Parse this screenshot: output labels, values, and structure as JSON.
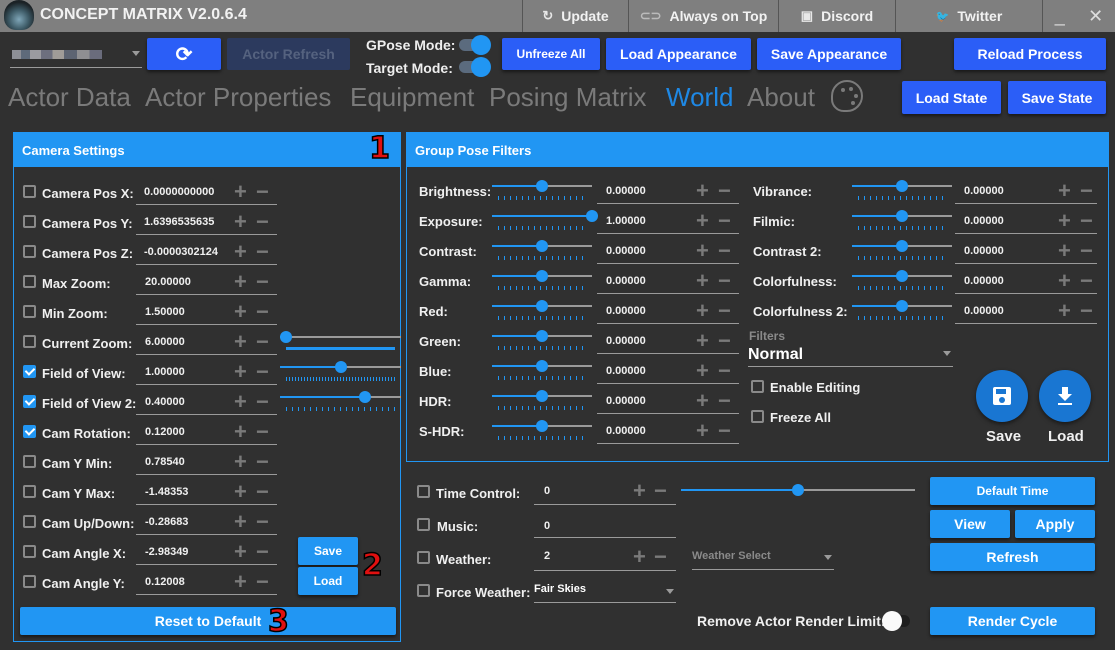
{
  "app": {
    "title": "CONCEPT MATRIX V2.0.6.4"
  },
  "titlebar": {
    "buttons": [
      {
        "label": "Update",
        "icon": "update-icon",
        "glyph": "↻"
      },
      {
        "label": "Always on Top",
        "icon": "toggle-icon",
        "glyph": "⊂⊃"
      },
      {
        "label": "Discord",
        "icon": "discord-icon",
        "glyph": "▣"
      },
      {
        "label": "Twitter",
        "icon": "twitter-icon",
        "glyph": "🐦"
      }
    ],
    "minimize": "_",
    "close": "✕"
  },
  "toolbar": {
    "refresh_glyph": "⟳",
    "actor_refresh": "Actor Refresh",
    "gpose_mode": "GPose Mode:",
    "target_mode": "Target Mode:",
    "gpose_on": true,
    "target_on": true,
    "unfreeze_all": "Unfreeze All",
    "load_appearance": "Load Appearance",
    "save_appearance": "Save Appearance",
    "reload_process": "Reload Process",
    "load_state": "Load State",
    "save_state": "Save State"
  },
  "tabs": [
    {
      "label": "Actor Data",
      "active": false
    },
    {
      "label": "Actor Properties",
      "active": false
    },
    {
      "label": "Equipment",
      "active": false
    },
    {
      "label": "Posing Matrix",
      "active": false
    },
    {
      "label": "World",
      "active": true
    },
    {
      "label": "About",
      "active": false
    }
  ],
  "palette_glyph": "🎨",
  "camera": {
    "title": "Camera Settings",
    "marker1": "1",
    "marker2": "2",
    "marker3": "3",
    "rows": [
      {
        "label": "Camera Pos X:",
        "value": "0.0000000000",
        "checked": false
      },
      {
        "label": "Camera Pos Y:",
        "value": "1.6396535635",
        "checked": false
      },
      {
        "label": "Camera Pos Z:",
        "value": "-0.0000302124",
        "checked": false
      },
      {
        "label": "Max Zoom:",
        "value": "20.00000",
        "checked": false
      },
      {
        "label": "Min Zoom:",
        "value": "1.50000",
        "checked": false
      },
      {
        "label": "Current Zoom:",
        "value": "6.00000",
        "checked": false
      },
      {
        "label": "Field of View:",
        "value": "1.00000",
        "checked": true
      },
      {
        "label": "Field of View 2:",
        "value": "0.40000",
        "checked": true
      },
      {
        "label": "Cam Rotation:",
        "value": "0.12000",
        "checked": true
      },
      {
        "label": "Cam Y Min:",
        "value": "0.78540",
        "checked": false
      },
      {
        "label": "Cam Y Max:",
        "value": "-1.48353",
        "checked": false
      },
      {
        "label": "Cam Up/Down:",
        "value": "-0.28683",
        "checked": false
      },
      {
        "label": "Cam Angle X:",
        "value": "-2.98349",
        "checked": false
      },
      {
        "label": "Cam Angle Y:",
        "value": "0.12008",
        "checked": false
      }
    ],
    "sliders": {
      "current_zoom": 0.05,
      "field_of_view": 0.5,
      "field_of_view_2": 0.7
    },
    "save": "Save",
    "load": "Load",
    "reset": "Reset to Default"
  },
  "filters": {
    "title": "Group Pose Filters",
    "left": [
      {
        "label": "Brightness:",
        "value": "0.00000",
        "pos": 0.5
      },
      {
        "label": "Exposure:",
        "value": "1.00000",
        "pos": 1.0
      },
      {
        "label": "Contrast:",
        "value": "0.00000",
        "pos": 0.5
      },
      {
        "label": "Gamma:",
        "value": "0.00000",
        "pos": 0.5
      },
      {
        "label": "Red:",
        "value": "0.00000",
        "pos": 0.5
      },
      {
        "label": "Green:",
        "value": "0.00000",
        "pos": 0.5
      },
      {
        "label": "Blue:",
        "value": "0.00000",
        "pos": 0.5
      },
      {
        "label": "HDR:",
        "value": "0.00000",
        "pos": 0.5
      },
      {
        "label": "S-HDR:",
        "value": "0.00000",
        "pos": 0.5
      }
    ],
    "right": [
      {
        "label": "Vibrance:",
        "value": "0.00000",
        "pos": 0.5
      },
      {
        "label": "Filmic:",
        "value": "0.00000",
        "pos": 0.5
      },
      {
        "label": "Contrast 2:",
        "value": "0.00000",
        "pos": 0.5
      },
      {
        "label": "Colorfulness:",
        "value": "0.00000",
        "pos": 0.5
      },
      {
        "label": "Colorfulness 2:",
        "value": "0.00000",
        "pos": 0.5
      }
    ],
    "filters_label": "Filters",
    "filters_value": "Normal",
    "enable_editing": "Enable Editing",
    "freeze_all": "Freeze All",
    "save": "Save",
    "load": "Load"
  },
  "world": {
    "time_control": "Time Control:",
    "time_value": "0",
    "time_slider": 0.5,
    "music": "Music:",
    "music_value": "0",
    "weather": "Weather:",
    "weather_value": "2",
    "weather_select": "Weather Select",
    "force_weather": "Force Weather:",
    "force_weather_value": "Fair Skies",
    "remove_render_limit": "Remove Actor Render Limit:",
    "render_limit_on": false,
    "default_time": "Default Time",
    "view": "View",
    "apply": "Apply",
    "refresh": "Refresh",
    "render_cycle": "Render Cycle"
  },
  "pm": {
    "plus": "+",
    "minus": "−"
  }
}
